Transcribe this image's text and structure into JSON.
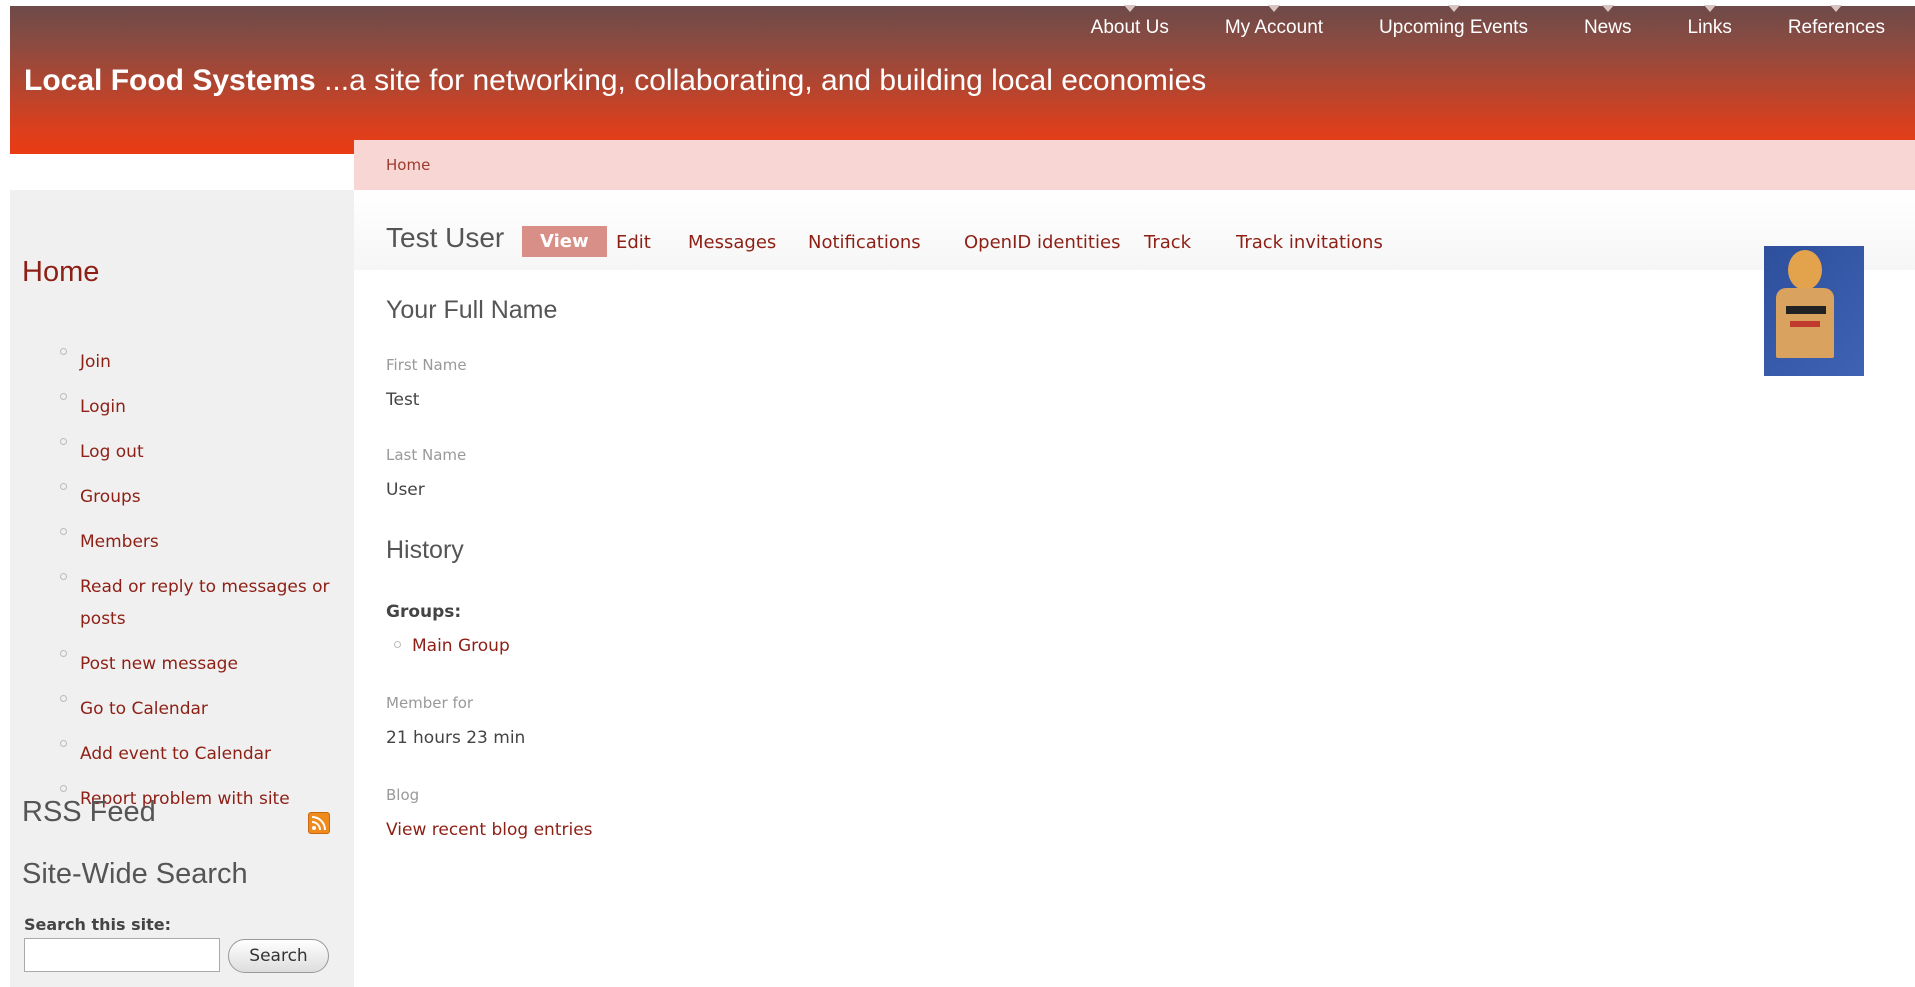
{
  "header": {
    "nav": [
      "About Us",
      "My Account",
      "Upcoming Events",
      "News",
      "Links",
      "References"
    ],
    "site_name": "Local Food Systems",
    "tagline": "...a site for networking, collaborating, and building local economies"
  },
  "breadcrumb": "Home",
  "sidebar": {
    "title": "Home",
    "items": [
      "Join",
      "Login",
      "Log out",
      "Groups",
      "Members",
      "Read or reply to messages or posts",
      "Post new message",
      "Go to Calendar",
      "Add event to Calendar",
      "Report problem with site"
    ],
    "rss_title": "RSS Feed",
    "search_title": "Site-Wide Search",
    "search_label": "Search this site:",
    "search_button": "Search",
    "search_value": ""
  },
  "main": {
    "user_title": "Test User",
    "tabs": [
      "View",
      "Edit",
      "Messages",
      "Notifications",
      "OpenID identities",
      "Track",
      "Track invitations"
    ],
    "active_tab": "View",
    "full_name_heading": "Your Full Name",
    "first_name_label": "First Name",
    "first_name_value": "Test",
    "last_name_label": "Last Name",
    "last_name_value": "User",
    "history_heading": "History",
    "groups_label": "Groups:",
    "groups_value": "Main Group",
    "member_for_label": "Member for",
    "member_for_value": "21 hours 23 min",
    "blog_label": "Blog",
    "blog_link": "View recent blog entries"
  },
  "colors": {
    "accent_link": "#8d1f15",
    "header_red": "#ea3b14",
    "active_tab": "#d78f88"
  }
}
